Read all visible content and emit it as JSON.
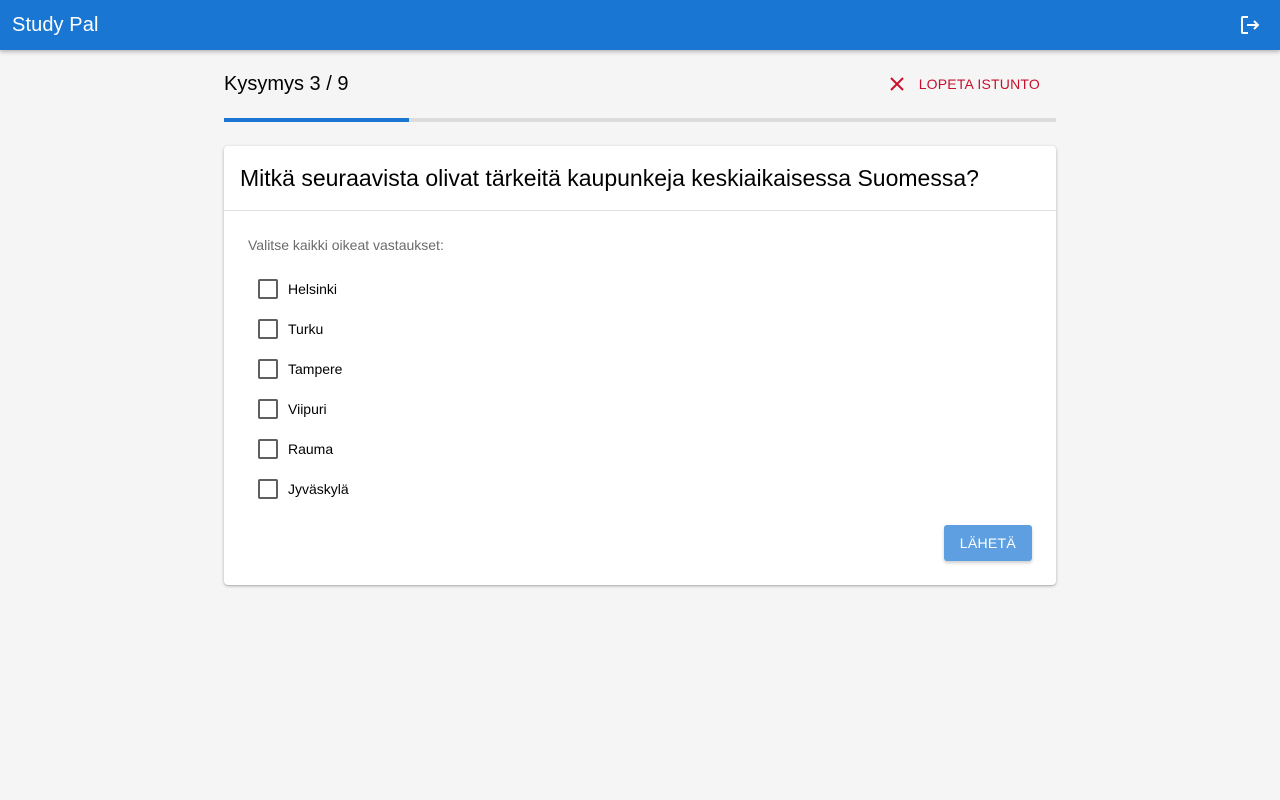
{
  "app": {
    "title": "Study Pal",
    "logout_icon": "logout-icon"
  },
  "session": {
    "progress_label": "Kysymys 3 / 9",
    "progress_fraction": 0.222,
    "quit_label": "LOPETA ISTUNTO",
    "quit_icon": "close-icon",
    "accent_color": "#1976d2",
    "quit_color": "#c8102e"
  },
  "question": {
    "text": "Mitkä seuraavista olivat tärkeitä kaupunkeja keskiaikaisessa Suomessa?",
    "instruction": "Valitse kaikki oikeat vastaukset:",
    "options": [
      {
        "label": "Helsinki",
        "checked": false
      },
      {
        "label": "Turku",
        "checked": false
      },
      {
        "label": "Tampere",
        "checked": false
      },
      {
        "label": "Viipuri",
        "checked": false
      },
      {
        "label": "Rauma",
        "checked": false
      },
      {
        "label": "Jyväskylä",
        "checked": false
      }
    ],
    "submit_label": "LÄHETÄ"
  }
}
